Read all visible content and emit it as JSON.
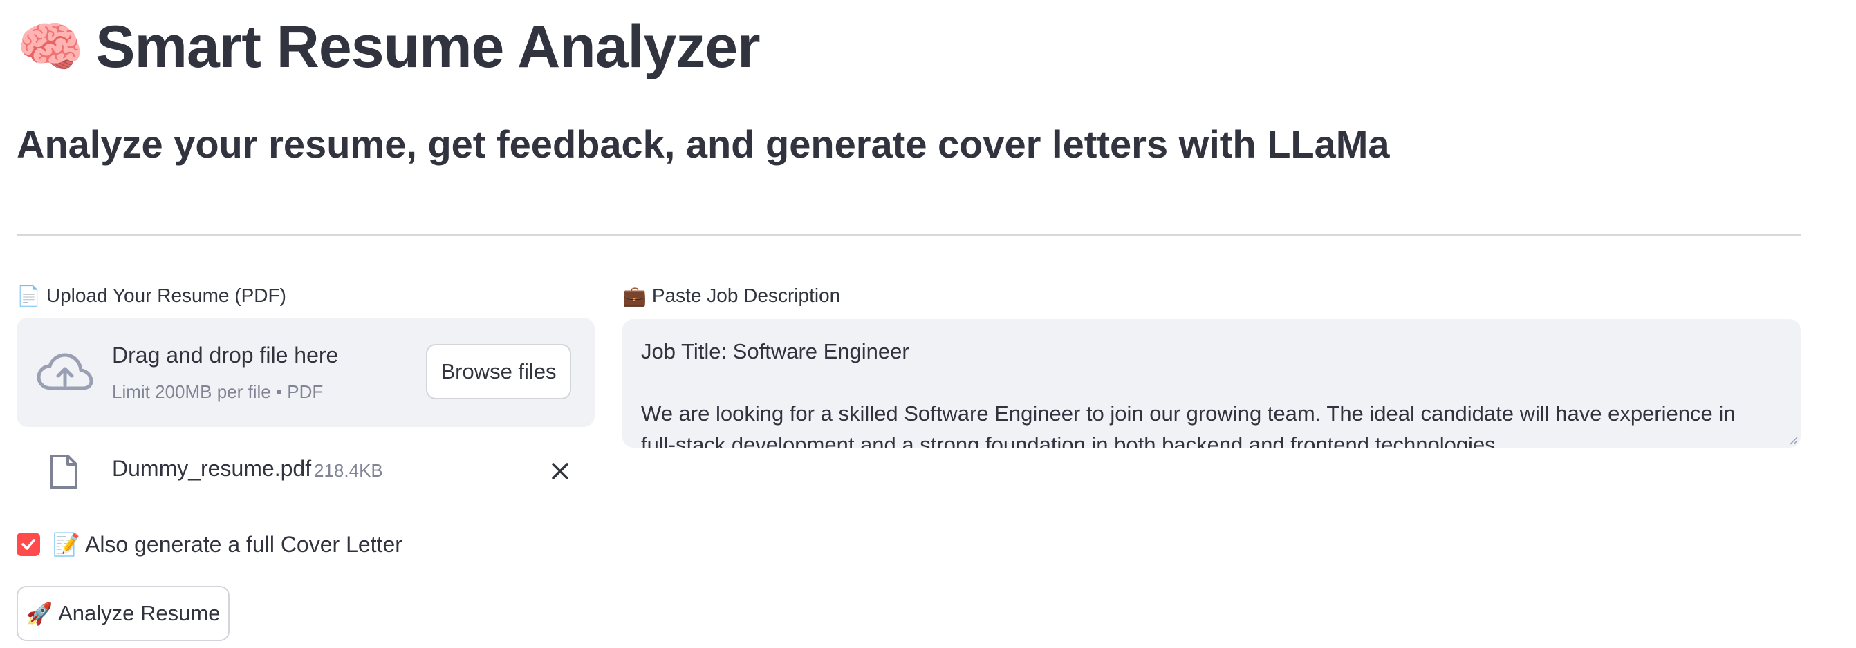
{
  "header": {
    "title_emoji": "🧠",
    "title": "Smart Resume Analyzer",
    "subtitle": "Analyze your resume, get feedback, and generate cover letters with LLaMa"
  },
  "upload": {
    "label_icon": "📄",
    "label": "Upload Your Resume (PDF)",
    "dropzone_icon": "cloud-upload-icon",
    "dropzone_title": "Drag and drop file here",
    "dropzone_subtitle": "Limit 200MB per file • PDF",
    "browse_label": "Browse files",
    "file": {
      "icon": "document-icon",
      "name": "Dummy_resume.pdf",
      "size": "218.4KB"
    }
  },
  "options": {
    "cover_letter_checked": true,
    "cover_letter_icon": "📝",
    "cover_letter_label": "Also generate a full Cover Letter"
  },
  "actions": {
    "analyze_icon": "🚀",
    "analyze_label": "Analyze Resume"
  },
  "job": {
    "label_icon": "💼",
    "label": "Paste Job Description",
    "text": "Job Title: Software Engineer\n\nWe are looking for a skilled Software Engineer to join our growing team. The ideal candidate will have experience in full-stack development and a strong foundation in both backend and frontend technologies."
  },
  "colors": {
    "text": "#31333f",
    "muted": "#808495",
    "input_bg": "#f0f2f6",
    "accent": "#ff4b4b",
    "divider": "#d7d8dc"
  }
}
